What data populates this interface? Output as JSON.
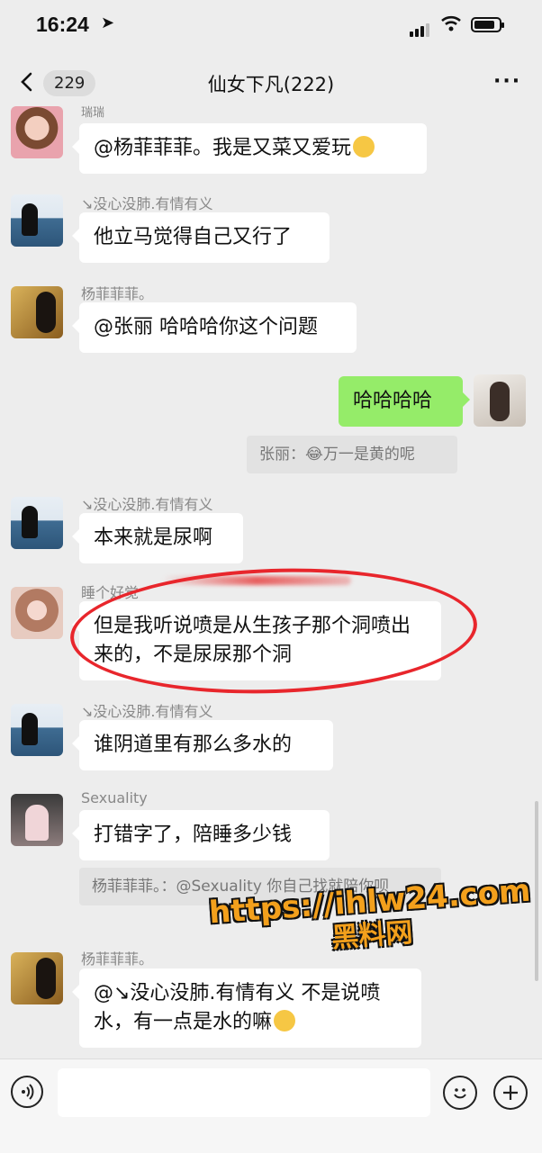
{
  "status": {
    "time": "16:24"
  },
  "nav": {
    "back_count": "229",
    "title": "仙女下凡(222)",
    "more": "···"
  },
  "messages": [
    {
      "sender": "瑞瑞",
      "text": "@杨菲菲菲。我是又菜又爱玩",
      "emoji": "thinking-face"
    },
    {
      "sender": "↘没心没肺.有情有义",
      "text": "他立马觉得自己又行了"
    },
    {
      "sender": "杨菲菲菲。",
      "text": "@张丽 哈哈哈你这个问题"
    },
    {
      "sender": "self",
      "text": "哈哈哈哈",
      "quote": "张丽：😂万一是黄的呢"
    },
    {
      "sender": "↘没心没肺.有情有义",
      "text": "本来就是尿啊"
    },
    {
      "sender": "睡个好觉",
      "text": "但是我听说喷是从生孩子那个洞喷出来的，不是尿尿那个洞"
    },
    {
      "sender": "↘没心没肺.有情有义",
      "text": "谁阴道里有那么多水的"
    },
    {
      "sender": "Sexuality",
      "text": "打错字了，陪睡多少钱",
      "quote": "杨菲菲菲。：@Sexuality 你自己找就陪你呗"
    },
    {
      "sender": "杨菲菲菲。",
      "text": "@↘没心没肺.有情有义 不是说喷水，有一点是水的嘛",
      "emoji": "laughing-face"
    }
  ],
  "watermark": {
    "line1": "https://ihlw24.com",
    "line2": "黑料网"
  },
  "colors": {
    "accent_bubble": "#95ec69",
    "annotation": "#e8262c",
    "watermark": "#f3a01c"
  }
}
